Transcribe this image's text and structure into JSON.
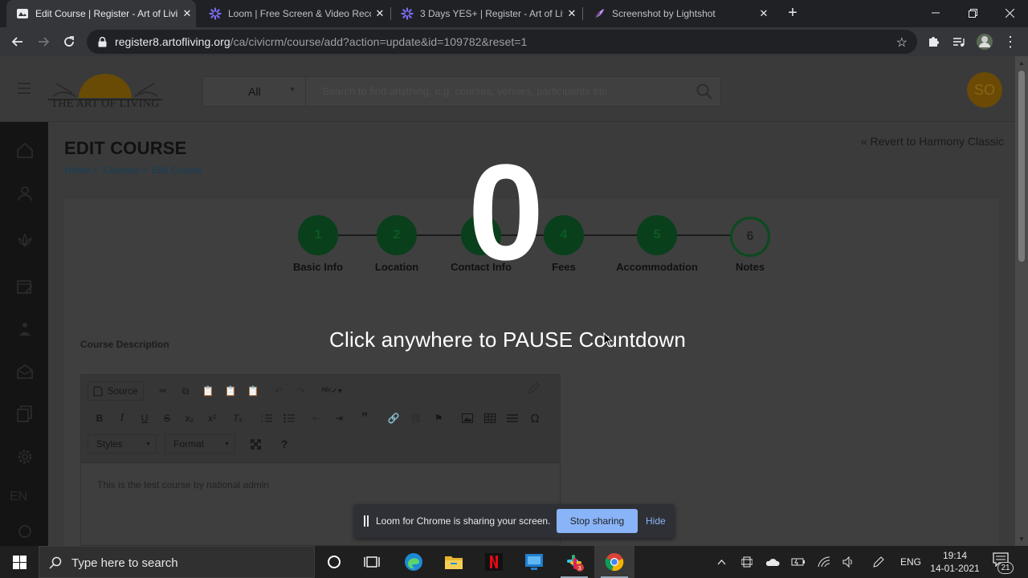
{
  "browser": {
    "tabs": [
      {
        "title": "Edit Course | Register - Art of Living",
        "active": true,
        "icon": "aol-favicon"
      },
      {
        "title": "Loom | Free Screen & Video Recording",
        "active": false,
        "icon": "loom-favicon"
      },
      {
        "title": "3 Days YES+ | Register - Art of Living",
        "active": false,
        "icon": "loom-favicon"
      },
      {
        "title": "Screenshot by Lightshot",
        "active": false,
        "icon": "lightshot-feather-favicon"
      }
    ],
    "url_host": "register8.artofliving.org",
    "url_path": "/ca/civicrm/course/add?action=update&id=109782&reset=1"
  },
  "app": {
    "logo_text": "THE ART OF LIVING",
    "search_scope": "All",
    "search_placeholder": "Search to find anything, e.g. courses, venues, participants etc.",
    "avatar_initials": "SO",
    "sidebar_lang": "EN"
  },
  "page": {
    "title": "EDIT COURSE",
    "breadcrumbs": [
      "Home",
      "Courses",
      "Edit Course"
    ],
    "revert_link": "Revert to Harmony Classic",
    "steps": [
      {
        "num": "1",
        "label": "Basic Info",
        "completed": true
      },
      {
        "num": "2",
        "label": "Location",
        "completed": true
      },
      {
        "num": "3",
        "label": "Contact Info",
        "completed": true
      },
      {
        "num": "4",
        "label": "Fees",
        "completed": true
      },
      {
        "num": "5",
        "label": "Accommodation",
        "completed": true
      },
      {
        "num": "6",
        "label": "Notes",
        "completed": false
      }
    ],
    "description_label": "Course Description",
    "editor": {
      "source_label": "Source",
      "styles_label": "Styles",
      "format_label": "Format",
      "help_label": "?",
      "body_text": "This is the test course by national admin"
    }
  },
  "overlay": {
    "countdown": "0",
    "pause_message": "Click anywhere to PAUSE Countdown"
  },
  "loom_bar": {
    "message": "Loom for Chrome is sharing your screen.",
    "stop_label": "Stop sharing",
    "hide_label": "Hide"
  },
  "taskbar": {
    "search_placeholder": "Type here to search",
    "language": "ENG",
    "time": "19:14",
    "date": "14-01-2021",
    "notification_count": "21"
  }
}
